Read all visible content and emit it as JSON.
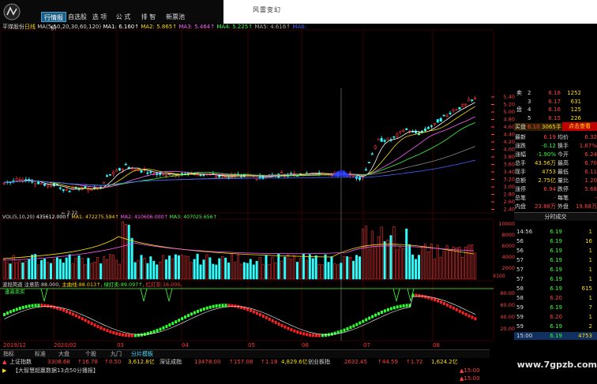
{
  "nav": {
    "tabs": [
      "行情报价",
      "自选股",
      "选 项",
      "公 式",
      "排 智",
      "新票池"
    ],
    "brand": "风雷变幻"
  },
  "main_chart": {
    "stock": "平煤股份",
    "period": "日线",
    "ma_params": "MA(5,10,20,30,60,120)",
    "ma1": "MA1: 6.160↑",
    "ma2": "MA2: 5.865↑",
    "ma3": "MA3: 5.464↑",
    "ma4": "MA4: 5.225↑",
    "ma5": "MA5: 4.616↑",
    "ma6": "MA6:",
    "low_mark": "2.22",
    "y_ticks": [
      "5.40",
      "5.20",
      "5.00",
      "4.80",
      "4.60",
      "4.40",
      "4.20",
      "4.00",
      "3.80",
      "3.60",
      "3.40",
      "3.20",
      "3.00",
      "2.80",
      "2.60",
      "2.40"
    ]
  },
  "volume_chart": {
    "label": "VOL(5,10,20)",
    "vol": "435612.000↑",
    "ma1": "MA1: 472275.594↑",
    "ma2": "MA2: 410606.000↑",
    "ma3": "MA3: 407025.656↑",
    "y_ticks": [
      "10000",
      "8000",
      "6000",
      "4000",
      "2000"
    ],
    "unit": "X100"
  },
  "indicator": {
    "name": "波段简道",
    "a": "注意防:",
    "a_val": "88.000,",
    "b": "主曲线:",
    "b_val": "88.013↑,",
    "c": "绿灯卖:",
    "c_val": "89.097↑,",
    "d": "红灯买:",
    "d_val": "16.000,",
    "caption": "逢高卖买",
    "y_ticks": [
      "80.00",
      "60.00",
      "40.00",
      "20.00"
    ]
  },
  "dates": [
    "2019/12",
    "2020/02",
    "03",
    "04",
    "05",
    "06",
    "07",
    "08"
  ],
  "order_book": {
    "asks": [
      [
        "卖",
        "2",
        "6.18",
        "1252"
      ],
      [
        "",
        "3",
        "6.17",
        "631"
      ],
      [
        "盘",
        "4",
        "6.16",
        "125"
      ],
      [
        "",
        "5",
        "6.15",
        "226"
      ]
    ],
    "buy_label": "买盘",
    "buy1": "6.10",
    "buy1_vol": "3065手",
    "click_view": "点击查看"
  },
  "quote": {
    "rows": [
      [
        "最新",
        "6.19",
        "均价",
        "6.32"
      ],
      [
        "涨跌",
        "-0.12",
        "换手",
        "1.87%"
      ],
      [
        "涨幅",
        "-1.90%",
        "今开",
        "6.24"
      ],
      [
        "总手",
        "43.56万",
        "最高",
        "6.70"
      ],
      [
        "现手",
        "4753",
        "最低",
        "6.11"
      ],
      [
        "总额",
        "2.75亿",
        "量比",
        "1.20"
      ],
      [
        "涨停",
        "6.94",
        "跌停",
        "5.68"
      ],
      [
        "总笔",
        "-",
        "每笔",
        "-"
      ],
      [
        "内盘",
        "23.88万",
        "外盘",
        "19.68万"
      ]
    ],
    "ticks_header": "分时成交",
    "ticks": [
      [
        "14:56",
        "6.19",
        "1"
      ],
      [
        "56",
        "6.19",
        "16"
      ],
      [
        "56",
        "6.19",
        "1"
      ],
      [
        "57",
        "6.19",
        "1"
      ],
      [
        "57",
        "6.19",
        "1"
      ],
      [
        "57",
        "6.19",
        "1"
      ],
      [
        "58",
        "6.19",
        "615"
      ],
      [
        "58",
        "6.20",
        "1"
      ],
      [
        "59",
        "6.19",
        "7"
      ],
      [
        "59",
        "6.20",
        "1"
      ],
      [
        "59",
        "6.19",
        "2"
      ],
      [
        "15:00",
        "6.19",
        "4753"
      ]
    ]
  },
  "bottom_tabs": [
    "指标",
    "标准",
    "大盘",
    "个股",
    "九门",
    "分片模板"
  ],
  "ticker": {
    "idx1_name": "上证指数",
    "idx1_val": "3308.68",
    "idx1_chg": "↑16.78",
    "idx1_pct": "↑0.50",
    "idx1_amt": "3,612.8亿",
    "idx2_name": "深证成指",
    "idx2_val": "13478.00",
    "idx2_chg": "↑157.08",
    "idx2_pct": "↑1.18",
    "idx2_amt": "4,829.6亿",
    "idx3_name": "创业板指",
    "idx3_val": "2632.45",
    "idx3_chg": "↑44.59",
    "idx3_pct": "↑1.72",
    "idx3_amt": "1,624.2亿"
  },
  "news": "【大智慧超赢数据13点50分播报】",
  "bottom_times": [
    "▲15:00",
    "▲15:00"
  ],
  "watermark": "www.7gpzb.com"
}
